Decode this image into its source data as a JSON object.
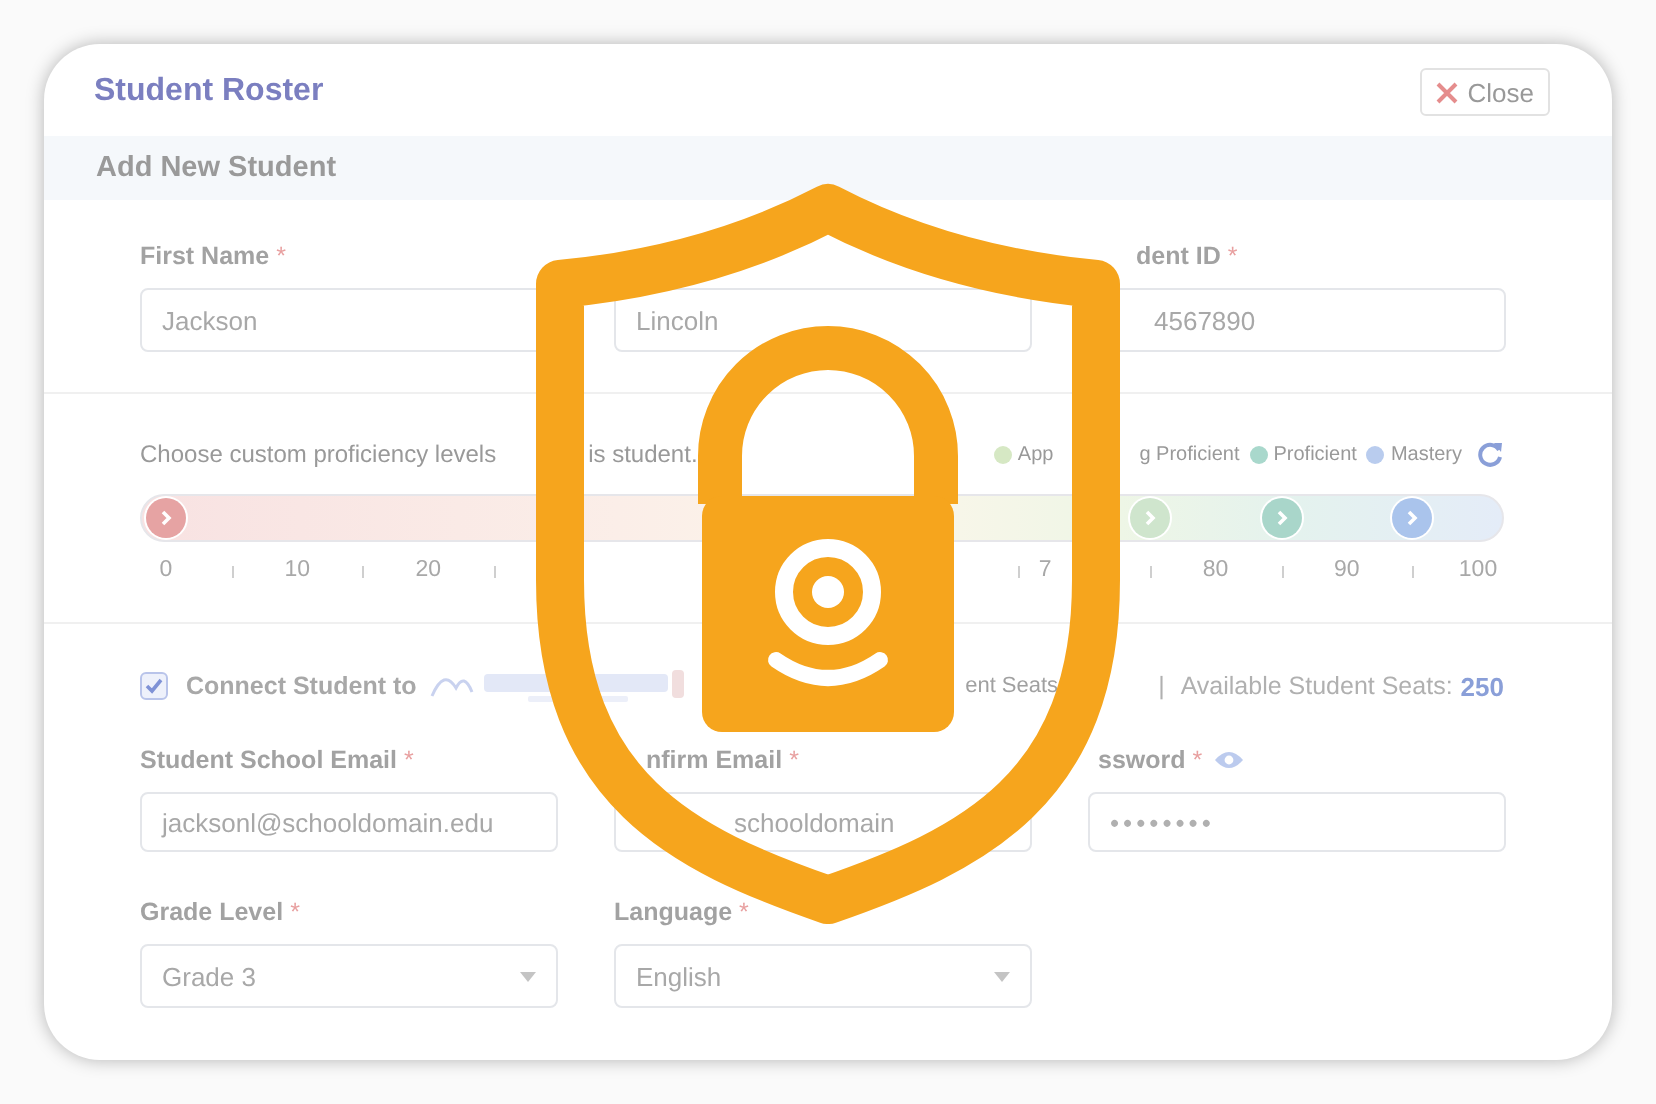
{
  "header": {
    "title": "Student Roster",
    "close_button": "Close"
  },
  "section_title": "Add New Student",
  "name_row": [
    {
      "label": "First Name",
      "required_mark": "*",
      "value": "Jackson"
    },
    {
      "value": "Lincoln"
    },
    {
      "label": "dent ID",
      "required_mark": "*",
      "value": "4567890"
    }
  ],
  "proficiency": {
    "prompt": [
      "Choose custom proficiency levels",
      "is student."
    ],
    "legend": [
      {
        "parts": [
          "App",
          "g Proficient"
        ],
        "color": "#d6e8c4"
      },
      {
        "parts": [
          "Proficient"
        ],
        "color": "#a9d8cc"
      },
      {
        "parts": [
          "Mastery"
        ],
        "color": "#b9ccee"
      }
    ],
    "thumbs": [
      {
        "level": 0,
        "color": "#e6a3a3"
      },
      {
        "level": 0.75,
        "color": "#cfe5cd"
      },
      {
        "level": 0.85,
        "color": "#a9d6ca"
      },
      {
        "level": 0.95,
        "color": "#aac4ec"
      }
    ],
    "ticks": [
      {
        "label": "0"
      },
      {
        "label": "10"
      },
      {
        "label": "20"
      },
      {
        "label": "7"
      },
      {
        "label": "80"
      },
      {
        "label": "90"
      },
      {
        "label": "100"
      }
    ]
  },
  "connect": {
    "checked": true,
    "label": "Connect Student to",
    "seats_fragment": "ent Seats",
    "separator": "|",
    "available_label": "Available Student Seats:",
    "available_value": "250"
  },
  "account_row": [
    {
      "kind": "text",
      "label": "Student School Email",
      "required_mark": "*",
      "value": "jacksonl@schooldomain.edu"
    },
    {
      "kind": "text",
      "label": "nfirm Email",
      "required_mark": "*",
      "value": "schooldomain"
    },
    {
      "kind": "password",
      "label": "ssword",
      "required_mark": "*",
      "value": "••••••••"
    }
  ],
  "select_row": [
    {
      "label": "Grade Level",
      "required_mark": "*",
      "value": "Grade 3"
    },
    {
      "label": "Language",
      "required_mark": "*",
      "value": "English"
    }
  ]
}
